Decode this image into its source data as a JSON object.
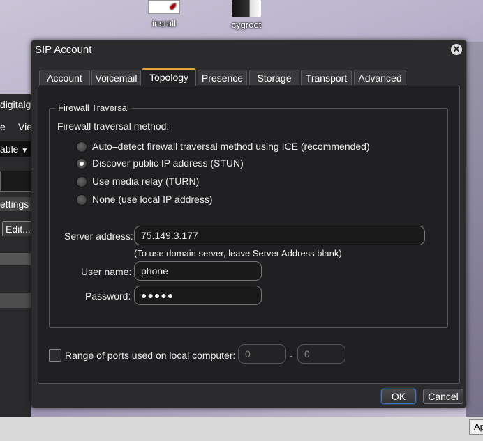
{
  "desktop": {
    "icons": [
      {
        "label": "insrall",
        "icon": "pdf-file-icon"
      },
      {
        "label": "cygroot",
        "icon": "book-icon"
      }
    ]
  },
  "background_app": {
    "row1": "digitalgl",
    "row2a": "e",
    "row2b": "Vie",
    "row3": "able",
    "row4": "ettings",
    "row5": "Edit...",
    "bottom_button": "Ap"
  },
  "dialog": {
    "title": "SIP Account",
    "tabs": [
      "Account",
      "Voicemail",
      "Topology",
      "Presence",
      "Storage",
      "Transport",
      "Advanced"
    ],
    "active_tab": "Topology",
    "firewall": {
      "group_title": "Firewall Traversal",
      "method_label": "Firewall traversal method:",
      "options": [
        "Auto–detect firewall traversal method using ICE (recommended)",
        "Discover public IP address (STUN)",
        "Use media relay (TURN)",
        "None (use local IP address)"
      ],
      "selected_index": 1,
      "server_label": "Server address:",
      "server_value": "75.149.3.177",
      "server_hint": "(To use domain server, leave Server Address blank)",
      "username_label": "User name:",
      "username_value": "phone",
      "password_label": "Password:",
      "password_value": "●●●●●"
    },
    "ports": {
      "label": "Range of ports used on local computer:",
      "from": "0",
      "separator": "-",
      "to": "0"
    },
    "ok_label": "OK",
    "cancel_label": "Cancel"
  }
}
